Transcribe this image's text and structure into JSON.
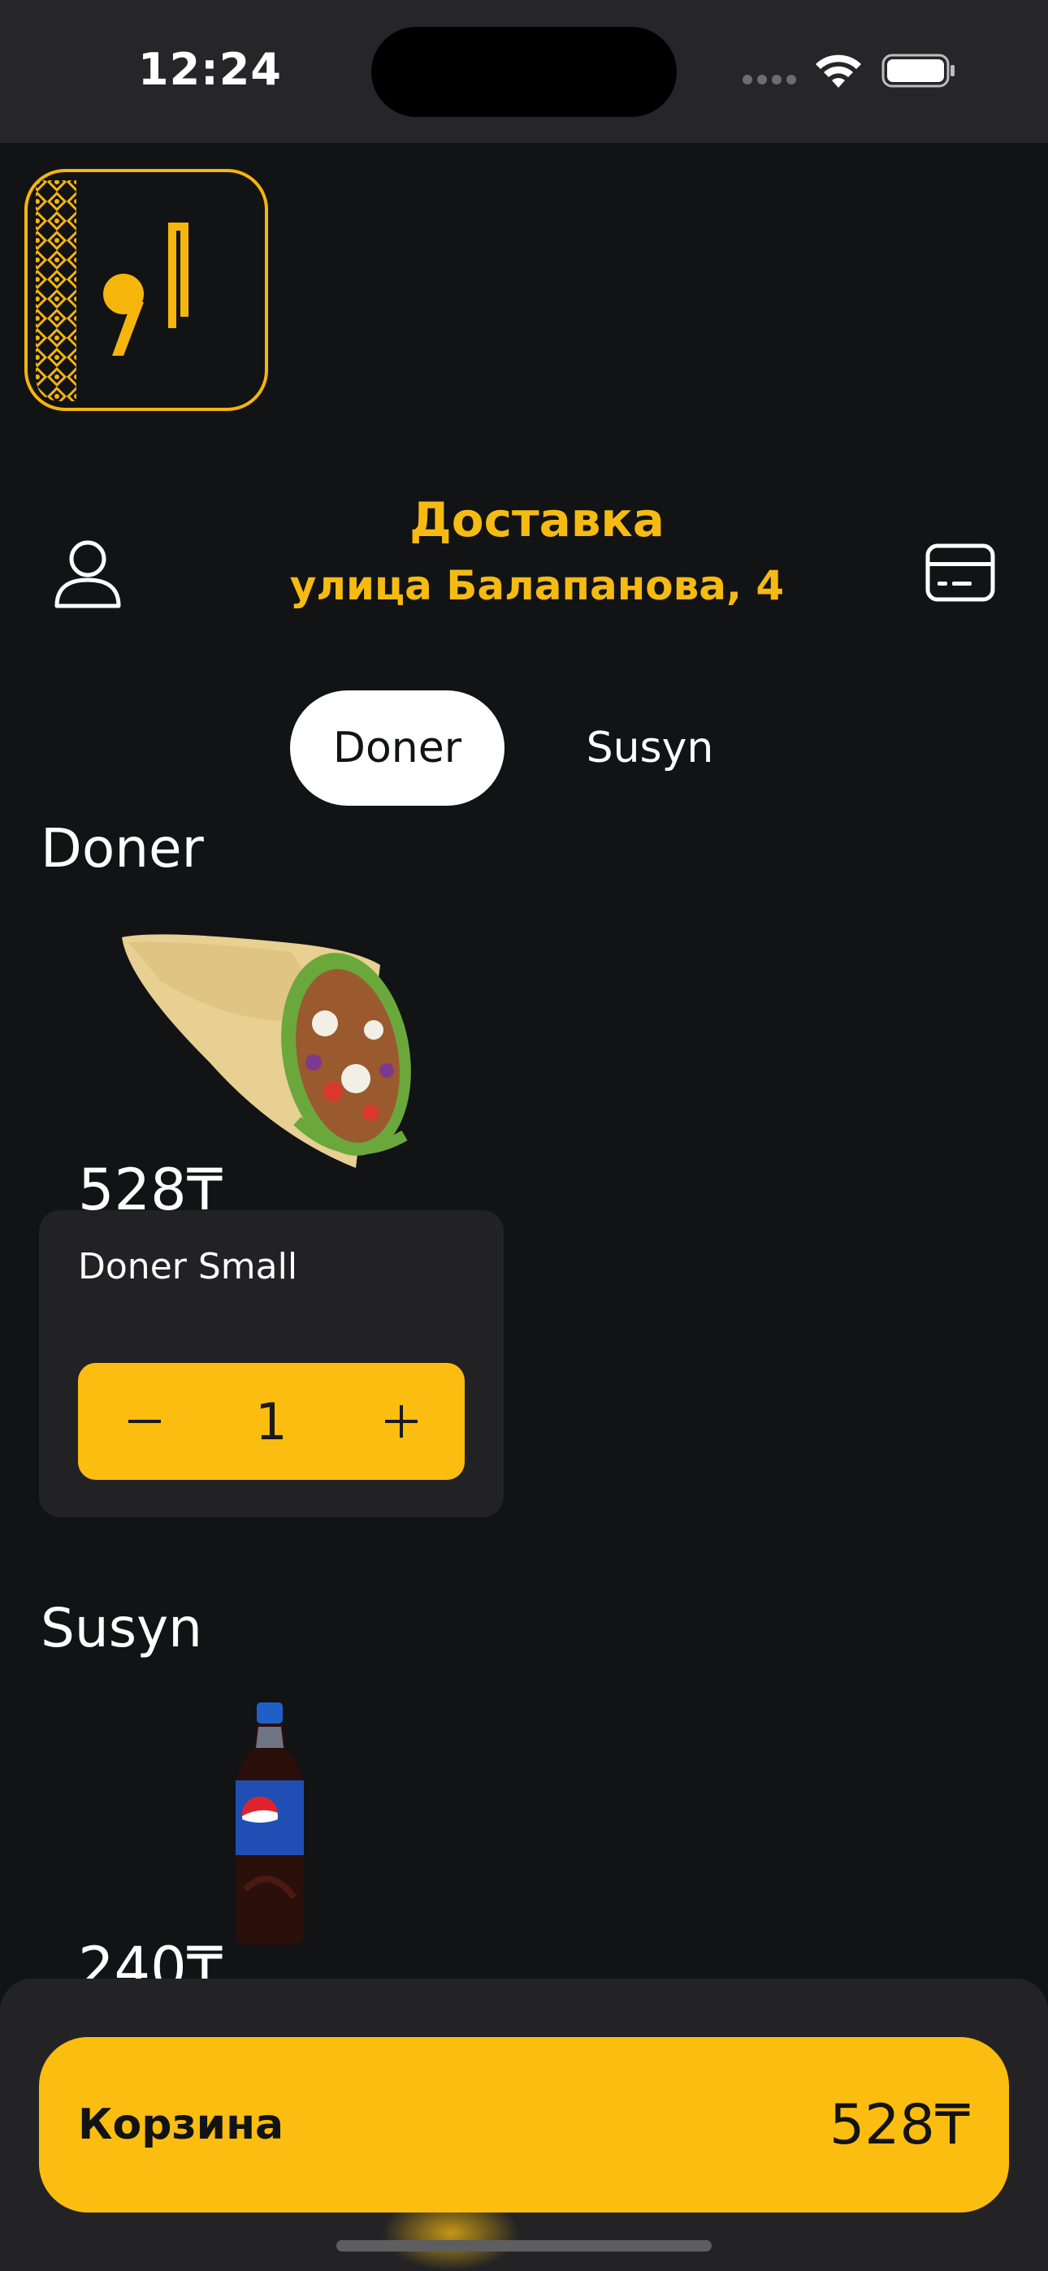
{
  "status_bar": {
    "time": "12:24"
  },
  "header": {
    "title": "Доставка",
    "address": "улица Балапанова, 4"
  },
  "tabs": [
    {
      "label": "Doner",
      "active": true
    },
    {
      "label": "Susyn",
      "active": false
    }
  ],
  "sections": [
    {
      "title": "Doner",
      "products": [
        {
          "name": "Doner Small",
          "price": "528₸",
          "quantity": "1",
          "image": "doner-wrap"
        }
      ]
    },
    {
      "title": "Susyn",
      "products": [
        {
          "price": "240₸",
          "image": "pepsi-bottle"
        }
      ]
    }
  ],
  "cart": {
    "label": "Корзина",
    "total": "528₸"
  },
  "colors": {
    "accent": "#fbbd0f",
    "background": "#121315",
    "card": "#222224"
  },
  "icons": [
    "profile-icon",
    "card-icon",
    "wifi-icon",
    "battery-icon",
    "minus-icon",
    "plus-icon"
  ]
}
